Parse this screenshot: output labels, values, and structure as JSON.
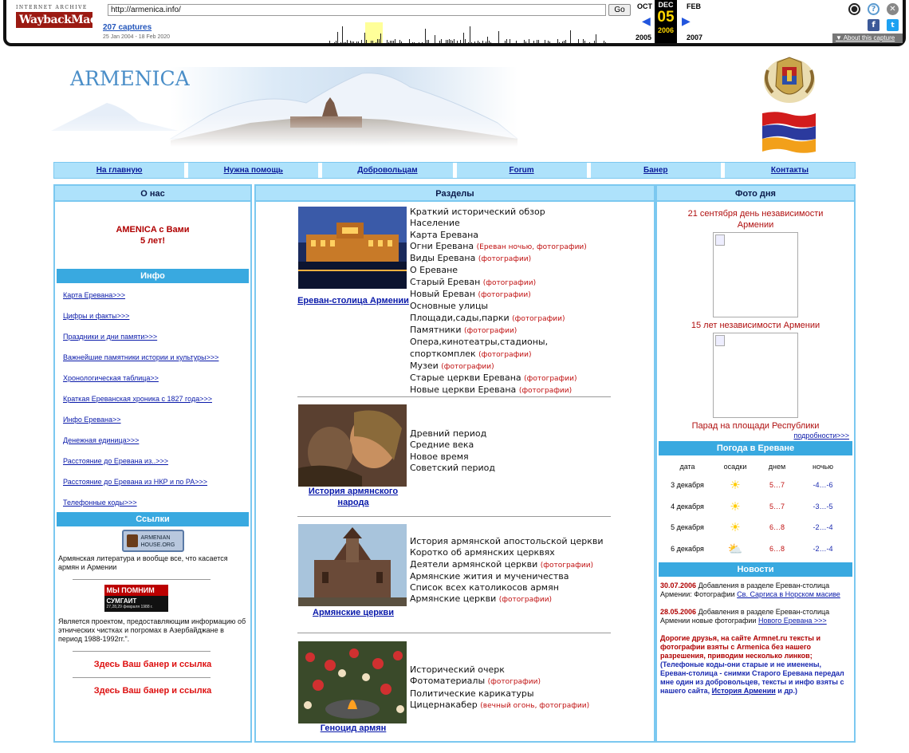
{
  "wayback": {
    "logo_top": "INTERNET ARCHIVE",
    "logo_main": "WaybackMachine",
    "url": "http://armenica.info/",
    "go": "Go",
    "captures": "207 captures",
    "range": "25 Jan 2004 - 18 Feb 2020",
    "prev_month": "OCT",
    "cur_month": "DEC",
    "next_month": "FEB",
    "day": "05",
    "prev_year": "2005",
    "cur_year": "2006",
    "next_year": "2007",
    "about": "About this capture",
    "colors": {
      "brand": "#9b1a12",
      "accent": "#ffd700",
      "link": "#2255bb"
    },
    "icons": [
      "user-icon",
      "help-icon",
      "close-icon",
      "facebook-icon",
      "twitter-icon"
    ]
  },
  "site": {
    "brand": "ARMENICA",
    "nav": [
      "На главную",
      "Нужна помощь",
      "Добровольцам",
      "Forum",
      "Банер",
      "Контакты"
    ],
    "left": {
      "head": "О нас",
      "anniv_1": "AMENICA с Вами",
      "anniv_2": "5 лет!",
      "info_head": "Инфо",
      "info_links": [
        "Карта Еревана>>>",
        "Цифры и факты>>>",
        "Праздники и дни памяти>>>",
        "Важнейшие памятники истории и культуры>>>",
        "Хронологическая таблица>>",
        "Краткая Ереванская хроника с 1827 года>>>",
        "Инфо Еревана>>",
        "Денежная единица>>>",
        "Расстояние до Еревана из..>>>",
        "Расстояние до Еревана из НКР и по РА>>>",
        "Телефонные коды>>>"
      ],
      "links_head": "Ссылки",
      "armhouse_1": "ARMENIAN",
      "armhouse_2": "HOUSE.ORG",
      "armhouse_desc": "Армянская литература и вообще все, что касается армян и Армении",
      "mp_1": "МЫ ПОМНИМ",
      "mp_2": "СУМГАИТ",
      "mp_3": "27,28,29 февраля 1988 г.",
      "mp_desc": "Является проектом, предоставляющим информацию об этнических чистках и погромах в Азербайджане в период 1988-1992гг.\".",
      "ad": "Здесь Ваш банер и ссылка"
    },
    "middle": {
      "head": "Разделы",
      "sections": [
        {
          "caption": "Ереван-столица Армении",
          "items": [
            {
              "t": "Краткий исторический обзор",
              "p": ""
            },
            {
              "t": "Население",
              "p": ""
            },
            {
              "t": "Карта Еревана",
              "p": ""
            },
            {
              "t": "Огни Еревана",
              "p": "(Ереван ночью, фотографии)"
            },
            {
              "t": "Виды Еревана",
              "p": "(фотографии)"
            },
            {
              "t": "О Ереване",
              "p": ""
            },
            {
              "t": "Старый Ереван",
              "p": "(фотографии)"
            },
            {
              "t": "Новый Ереван",
              "p": "(фотографии)"
            },
            {
              "t": "Основные улицы",
              "p": ""
            },
            {
              "t": "Площади,сады,парки",
              "p": "(фотографии)"
            },
            {
              "t": "Памятники",
              "p": "(фотографии)"
            },
            {
              "t": "Опера,кинотеатры,стадионы,",
              "p": ""
            },
            {
              "t": "спорткомплек",
              "p": "(фотографии)"
            },
            {
              "t": "Музеи",
              "p": "(фотографии)"
            },
            {
              "t": "Старые церкви Еревана",
              "p": "(фотографии)"
            },
            {
              "t": "Новые церкви Еревана",
              "p": "(фотографии)"
            }
          ]
        },
        {
          "caption": "История армянского народа",
          "items": [
            {
              "t": "Древний период",
              "p": ""
            },
            {
              "t": "Средние века",
              "p": ""
            },
            {
              "t": "Новое время",
              "p": ""
            },
            {
              "t": "Советский период",
              "p": ""
            }
          ]
        },
        {
          "caption": "Армянские церкви",
          "items": [
            {
              "t": "История армянской апостольской церкви",
              "p": ""
            },
            {
              "t": "Коротко об армянских церквях",
              "p": ""
            },
            {
              "t": "Деятели армянской церкви",
              "p": "(фотографии)"
            },
            {
              "t": "Армянские жития и мученичества",
              "p": ""
            },
            {
              "t": "Список всех католикосов армян",
              "p": ""
            },
            {
              "t": "Армянские церкви",
              "p": "(фотографии)"
            }
          ]
        },
        {
          "caption": "Геноцид армян",
          "items": [
            {
              "t": "Исторический очерк",
              "p": ""
            },
            {
              "t": "Фотоматериалы",
              "p": "(фотографии)"
            },
            {
              "t": "Политические карикатуры",
              "p": ""
            },
            {
              "t": "Цицернакабер",
              "p": "(вечный огонь, фотографии)"
            }
          ]
        }
      ]
    },
    "right": {
      "head": "Фото дня",
      "photo1": "21 сентября день независимости Армении",
      "photo2": "15 лет независимости Армении",
      "photo3": "Парад на площади Республики",
      "more": "подробности>>>",
      "weather_head": "Погода в Ереване",
      "weather_cols": [
        "дата",
        "осадки",
        "днем",
        "ночью"
      ],
      "weather": [
        {
          "date": "3 декабря",
          "day": "5…7",
          "night": "-4…-6"
        },
        {
          "date": "4 декабря",
          "day": "5…7",
          "night": "-3…-5"
        },
        {
          "date": "5 декабря",
          "day": "6…8",
          "night": "-2…-4"
        },
        {
          "date": "6 декабря",
          "day": "6…8",
          "night": "-2…-4"
        }
      ],
      "news_head": "Новости",
      "news1_date": "30.07.2006",
      "news1_text": "Добавления в разделе Ереван-столица Армении: Фотографии",
      "news1_link": "Св. Саргиса в Норском масиве",
      "news2_date": "28.05.2006",
      "news2_text": "Добавления в разделе Ереван-столица Армении новые фотографии",
      "news2_link": "Нового Еревана >>>",
      "news3_a": "Дорогие друзья, на сайте Armnet.ru тексты и фотографии взяты с Armenica без нашего разрешения, приводим несколько линков;",
      "news3_b": "(Телефоные коды-они старые и не именены, Ереван-столица - снимки Старого Еревана передал мне один из добровольцев, тексты и инфо взяты с нашего сайта,",
      "news3_link": "История Армении",
      "news3_c": "и др.)"
    }
  }
}
